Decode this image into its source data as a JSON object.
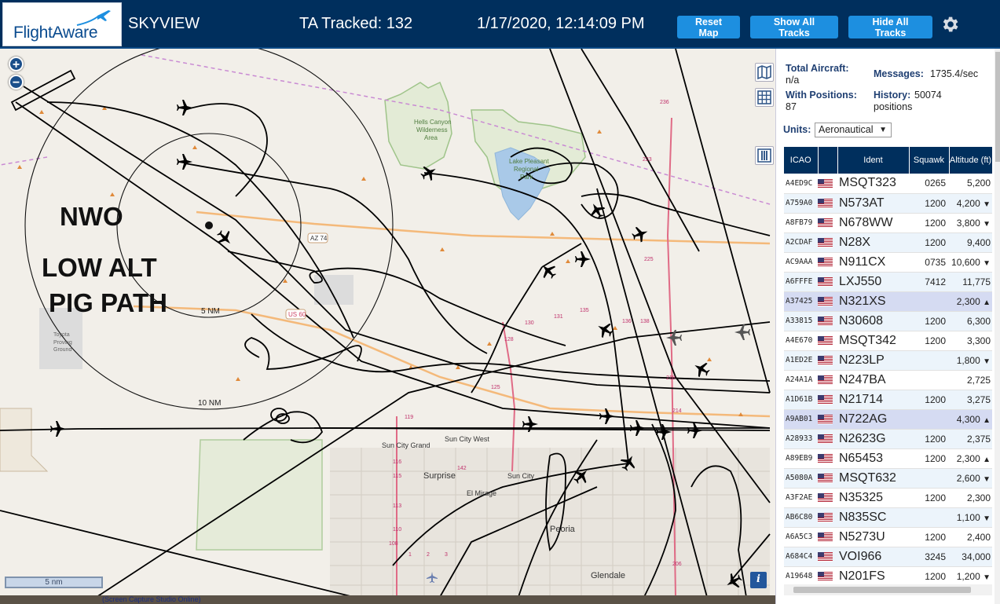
{
  "header": {
    "logo_text": "FlightAware",
    "app_title": "SKYVIEW",
    "tracked": "TA Tracked: 132",
    "datetime": "1/17/2020, 12:14:09 PM",
    "buttons": {
      "reset": "Reset Map",
      "show_all": "Show All Tracks",
      "hide_all": "Hide All Tracks"
    },
    "colors": {
      "bar": "#002f5d",
      "button": "#1d8fe0"
    },
    "icons": {
      "settings": "gear-icon",
      "logo": "airplane-icon"
    }
  },
  "map": {
    "annotation": {
      "line1": "NWO",
      "line2": "LOW ALT",
      "line3": "PIG PATH"
    },
    "range_rings": {
      "inner": "5 NM",
      "outer": "10 NM"
    },
    "places": {
      "hells_canyon": [
        "Hells Canyon",
        "Wilderness",
        "Area"
      ],
      "lake_pleasant": [
        "Lake Pleasant",
        "Regional",
        "Park"
      ],
      "proving_ground": [
        "Toyota",
        "Proving",
        "Ground"
      ],
      "sun_city_grand": "Sun City Grand",
      "sun_city_west": "Sun City West",
      "surprise": "Surprise",
      "sun_city": "Sun City",
      "el_mirage": "El Mirage",
      "peoria": "Peoria",
      "glendale": "Glendale"
    },
    "roads": {
      "az74": "AZ 74",
      "us60": "US 60"
    },
    "route_numbers": [
      "236",
      "225",
      "223",
      "218",
      "214",
      "206",
      "135",
      "130",
      "131",
      "136",
      "138",
      "128",
      "125",
      "119",
      "116",
      "115",
      "113",
      "110",
      "108",
      "1",
      "2",
      "3",
      "142"
    ],
    "scale_label": "5 nm",
    "info_label": "i",
    "zoom_in": "+",
    "zoom_out": "−",
    "bottom_text": "(Screen Capture Studio Online)"
  },
  "panel": {
    "total_aircraft_label": "Total Aircraft:",
    "total_aircraft_value": "n/a",
    "with_positions_label": "With Positions:",
    "with_positions_value": "87",
    "messages_label": "Messages:",
    "messages_value": "1735.4/sec",
    "history_label": "History:",
    "history_value_1": "50074",
    "history_value_2": "positions",
    "units_label": "Units:",
    "units_value": "Aeronautical",
    "columns": [
      "ICAO",
      "",
      "Ident",
      "Squawk",
      "Altitude (ft)"
    ],
    "rows": [
      {
        "icao": "A4ED9C",
        "ident": "MSQT323",
        "squawk": "0265",
        "alt": "5,200",
        "trend": ""
      },
      {
        "icao": "A759A0",
        "ident": "N573AT",
        "squawk": "1200",
        "alt": "4,200",
        "trend": "▼"
      },
      {
        "icao": "A8FB79",
        "ident": "N678WW",
        "squawk": "1200",
        "alt": "3,800",
        "trend": "▼"
      },
      {
        "icao": "A2CDAF",
        "ident": "N28X",
        "squawk": "1200",
        "alt": "9,400",
        "trend": ""
      },
      {
        "icao": "AC9AAA",
        "ident": "N911CX",
        "squawk": "0735",
        "alt": "10,600",
        "trend": "▼"
      },
      {
        "icao": "A6FFFE",
        "ident": "LXJ550",
        "squawk": "7412",
        "alt": "11,775",
        "trend": ""
      },
      {
        "icao": "A37425",
        "ident": "N321XS",
        "squawk": "",
        "alt": "2,300",
        "trend": "▲"
      },
      {
        "icao": "A33815",
        "ident": "N30608",
        "squawk": "1200",
        "alt": "6,300",
        "trend": ""
      },
      {
        "icao": "A4E670",
        "ident": "MSQT342",
        "squawk": "1200",
        "alt": "3,300",
        "trend": ""
      },
      {
        "icao": "A1ED2E",
        "ident": "N223LP",
        "squawk": "",
        "alt": "1,800",
        "trend": "▼"
      },
      {
        "icao": "A24A1A",
        "ident": "N247BA",
        "squawk": "",
        "alt": "2,725",
        "trend": ""
      },
      {
        "icao": "A1D61B",
        "ident": "N21714",
        "squawk": "1200",
        "alt": "3,275",
        "trend": ""
      },
      {
        "icao": "A9AB01",
        "ident": "N722AG",
        "squawk": "",
        "alt": "4,300",
        "trend": "▲"
      },
      {
        "icao": "A28933",
        "ident": "N2623G",
        "squawk": "1200",
        "alt": "2,375",
        "trend": ""
      },
      {
        "icao": "A89EB9",
        "ident": "N65453",
        "squawk": "1200",
        "alt": "2,300",
        "trend": "▲"
      },
      {
        "icao": "A5080A",
        "ident": "MSQT632",
        "squawk": "",
        "alt": "2,600",
        "trend": "▼"
      },
      {
        "icao": "A3F2AE",
        "ident": "N35325",
        "squawk": "1200",
        "alt": "2,300",
        "trend": ""
      },
      {
        "icao": "AB6C80",
        "ident": "N835SC",
        "squawk": "",
        "alt": "1,100",
        "trend": "▼"
      },
      {
        "icao": "A6A5C3",
        "ident": "N5273U",
        "squawk": "1200",
        "alt": "2,400",
        "trend": ""
      },
      {
        "icao": "A684C4",
        "ident": "VOI966",
        "squawk": "3245",
        "alt": "34,000",
        "trend": ""
      },
      {
        "icao": "A19648",
        "ident": "N201FS",
        "squawk": "1200",
        "alt": "1,200",
        "trend": "▼"
      }
    ],
    "selected_rows": [
      "A37425",
      "A9AB01"
    ]
  }
}
